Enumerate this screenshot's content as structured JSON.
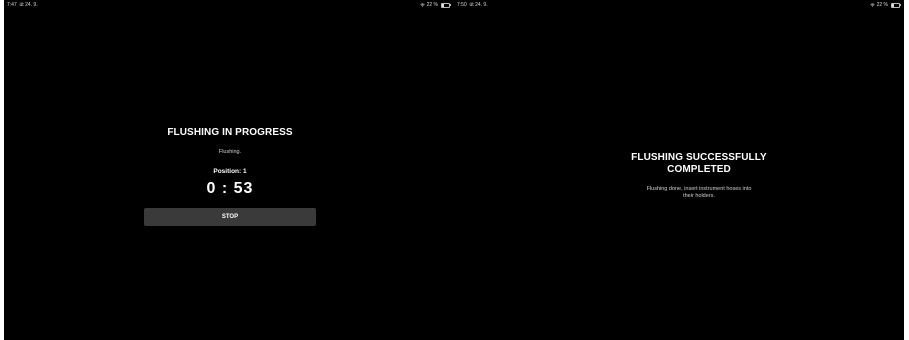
{
  "left_screen": {
    "status_bar": {
      "time": "7:47",
      "date": "út 24. 9.",
      "battery": "22 %"
    },
    "title": "FLUSHING IN PROGRESS",
    "status_text": "Flushing.",
    "position_label": "Position: 1",
    "timer": "0 : 53",
    "stop_label": "STOP"
  },
  "right_screen": {
    "status_bar": {
      "time": "7:50",
      "date": "út 24. 9.",
      "battery": "22 %"
    },
    "title_line1": "FLUSHING SUCCESSFULLY",
    "title_line2": "COMPLETED",
    "message_line1": "Flushing done, insert instrument hoses into",
    "message_line2": "their holders."
  },
  "icons": {
    "wifi": "wifi-icon",
    "battery": "battery-icon"
  },
  "colors": {
    "background": "#000000",
    "text": "#ffffff",
    "button": "#3a3a3a"
  }
}
